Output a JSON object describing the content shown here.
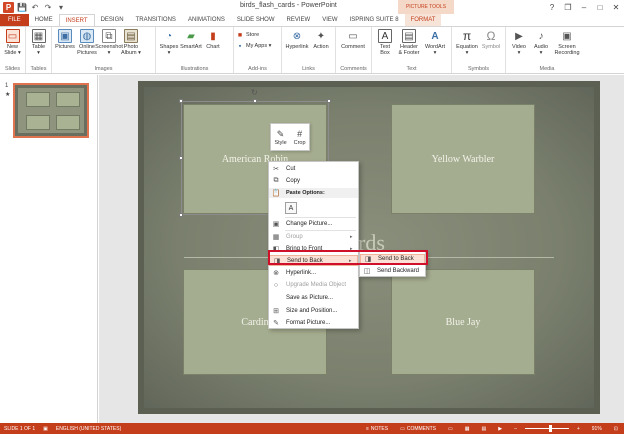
{
  "window": {
    "title": "birds_flash_cards - PowerPoint",
    "contextual_tab_group": "PICTURE TOOLS",
    "controls": {
      "help": "?",
      "restore": "❐",
      "minimize": "–",
      "maximize": "□",
      "close": "✕"
    }
  },
  "qat": {
    "save": "💾",
    "undo": "↶",
    "redo": "↷",
    "more": "▾"
  },
  "tabs": [
    {
      "id": "file",
      "label": "FILE"
    },
    {
      "id": "home",
      "label": "HOME"
    },
    {
      "id": "insert",
      "label": "INSERT"
    },
    {
      "id": "design",
      "label": "DESIGN"
    },
    {
      "id": "transitions",
      "label": "TRANSITIONS"
    },
    {
      "id": "animations",
      "label": "ANIMATIONS"
    },
    {
      "id": "slideshow",
      "label": "SLIDE SHOW"
    },
    {
      "id": "review",
      "label": "REVIEW"
    },
    {
      "id": "view",
      "label": "VIEW"
    },
    {
      "id": "ispring",
      "label": "ISPRING SUITE 8"
    },
    {
      "id": "format",
      "label": "FORMAT"
    }
  ],
  "ribbon": {
    "slides": {
      "label": "Slides",
      "new_slide": "New\nSlide ▾"
    },
    "tables": {
      "label": "Tables",
      "table": "Table\n▾"
    },
    "images": {
      "label": "Images",
      "pictures": "Pictures",
      "online_pictures": "Online\nPictures",
      "screenshot": "Screenshot\n▾",
      "photo_album": "Photo\nAlbum ▾"
    },
    "illustrations": {
      "label": "Illustrations",
      "shapes": "Shapes\n▾",
      "smartart": "SmartArt",
      "chart": "Chart"
    },
    "addins": {
      "label": "Add-ins",
      "store": "Store",
      "my_apps": "My Apps ▾"
    },
    "links": {
      "label": "Links",
      "hyperlink": "Hyperlink",
      "action": "Action"
    },
    "comments": {
      "label": "Comments",
      "comment": "Comment"
    },
    "text": {
      "label": "Text",
      "text_box": "Text\nBox",
      "header_footer": "Header\n& Footer",
      "wordart": "WordArt\n▾"
    },
    "symbols": {
      "label": "Symbols",
      "equation": "Equation\n▾",
      "symbol": "Symbol"
    },
    "media": {
      "label": "Media",
      "video": "Video\n▾",
      "audio": "Audio\n▾",
      "screen_recording": "Screen\nRecording"
    }
  },
  "thumbnails": {
    "slide_number": "1",
    "star": "★"
  },
  "slide": {
    "title_fragment": "rds",
    "cards": {
      "top_left": "American Robin",
      "top_right": "Yellow Warbler",
      "bottom_left": "Cardin",
      "bottom_right": "Blue Jay"
    }
  },
  "mini_toolbar": {
    "style": "Style",
    "crop": "Crop"
  },
  "context_menu": {
    "cut": "Cut",
    "copy": "Copy",
    "paste_options": "Paste Options:",
    "change_picture": "Change Picture...",
    "group": "Group",
    "bring_to_front": "Bring to Front",
    "send_to_back": "Send to Back",
    "hyperlink": "Hyperlink...",
    "upgrade_media": "Upgrade Media Object",
    "save_as_picture": "Save as Picture...",
    "size_position": "Size and Position...",
    "format_picture": "Format Picture..."
  },
  "submenu": {
    "send_to_back": "Send to Back",
    "send_backward": "Send Backward"
  },
  "statusbar": {
    "slide_of": "SLIDE 1 OF 1",
    "language": "ENGLISH (UNITED STATES)",
    "notes": "NOTES",
    "comments": "COMMENTS",
    "zoom": "91%",
    "zoom_fraction": 0.55
  }
}
